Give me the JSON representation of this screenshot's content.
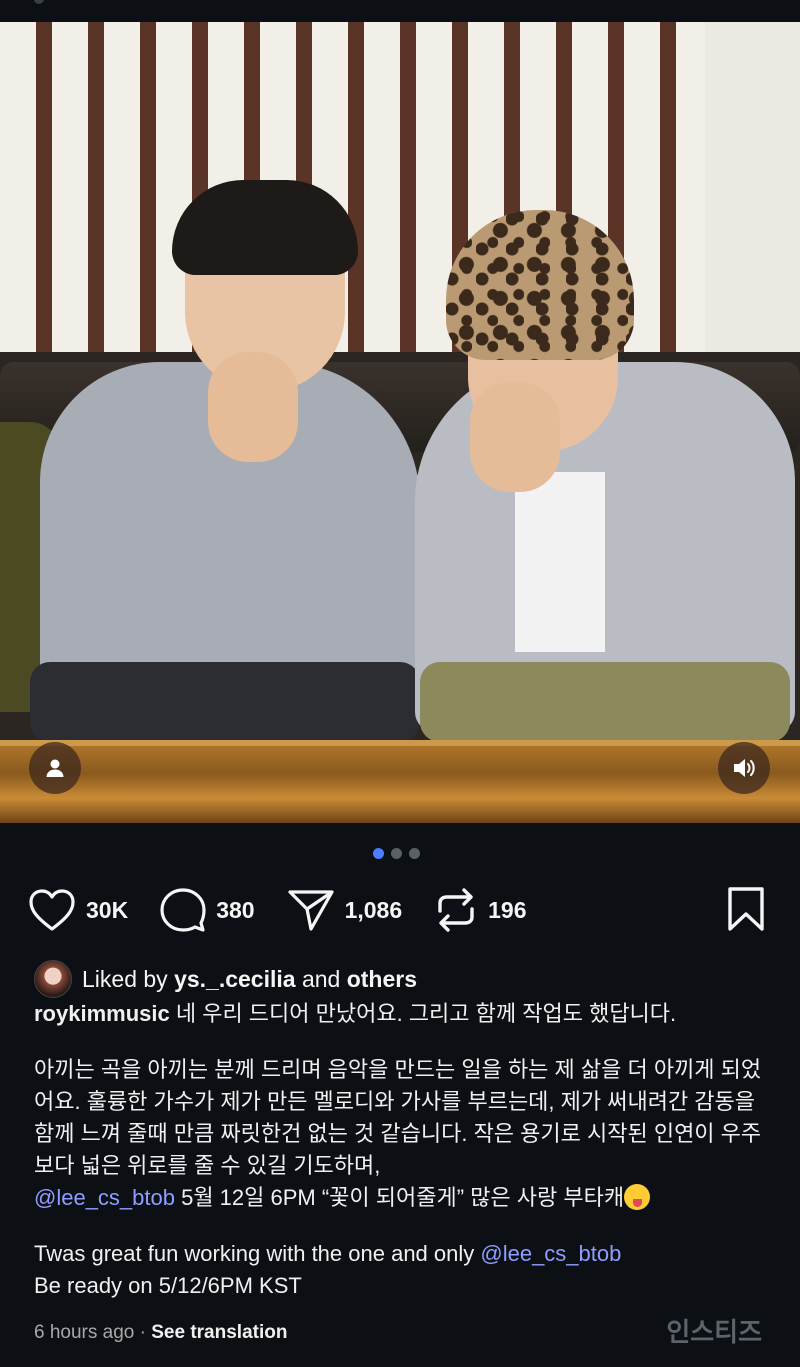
{
  "post": {
    "actions": {
      "likes": "30K",
      "comments": "380",
      "shares": "1,086",
      "reposts": "196"
    },
    "liked_by": {
      "prefix": "Liked by",
      "user": "ys._.cecilia",
      "joiner": "and",
      "others": "others"
    },
    "caption": {
      "username": "roykimmusic",
      "line1": "네 우리 드디어 만났어요. 그리고 함께 작업도 했답니다.",
      "para2": "아끼는 곡을 아끼는 분께 드리며 음악을 만드는 일을 하는 제 삶을 더 아끼게 되었어요. 훌륭한 가수가 제가 만든 멜로디와 가사를 부르는데, 제가 써내려간 감동을 함께 느껴 줄때 만큼 짜릿한건 없는 것 같습니다. 작은 용기로 시작된 인연이 우주보다 넓은 위로를 줄 수 있길 기도하며,",
      "mention1": "@lee_cs_btob",
      "release_text": " 5월 12일 6PM “꽃이 되어줄게” 많은 사랑 부타캐",
      "english_line1": "Twas great fun working with the one and only ",
      "mention2": "@lee_cs_btob",
      "english_line2": "Be ready on 5/12/6PM KST"
    },
    "time_ago": "6 hours ago",
    "separator": "·",
    "see_translation": "See translation",
    "carousel": {
      "count": 3,
      "active": 1
    }
  },
  "watermark": "인스티즈",
  "colors": {
    "background": "#0c1014",
    "mention": "#8e9dff",
    "carousel_active": "#4f7dff"
  },
  "icons": [
    "heart-icon",
    "comment-icon",
    "send-icon",
    "repost-icon",
    "bookmark-icon",
    "user-tag-icon",
    "sound-icon"
  ]
}
